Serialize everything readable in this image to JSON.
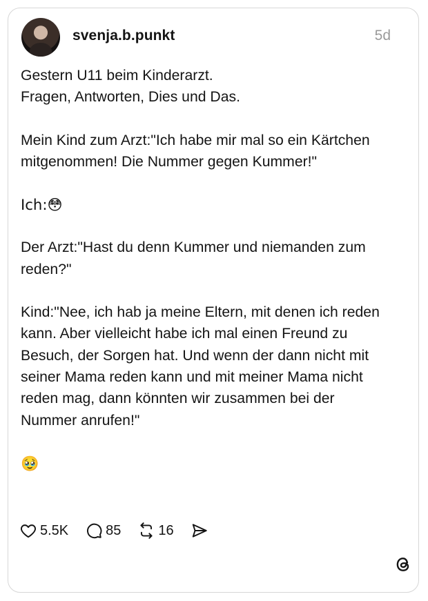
{
  "post": {
    "username": "svenja.b.punkt",
    "time": "5d",
    "paragraphs": [
      "Gestern U11 beim Kinderarzt.\nFragen, Antworten, Dies und Das.",
      "Mein Kind zum Arzt:\"Ich habe mir mal so ein Kärtchen mitgenommen! Die Nummer gegen Kummer!\"",
      "Ich:😳",
      "Der Arzt:\"Hast du denn Kummer und niemanden zum reden?\"",
      "Kind:\"Nee, ich hab ja meine Eltern, mit denen ich reden kann. Aber vielleicht habe ich mal einen Freund zu Besuch, der Sorgen hat. Und wenn der dann nicht mit seiner Mama reden kann und mit meiner Mama nicht reden mag, dann könnten wir zusammen bei der Nummer anrufen!\"",
      "🥹"
    ]
  },
  "actions": {
    "likes": "5.5K",
    "comments": "85",
    "reposts": "16"
  },
  "icons": [
    "heart-icon",
    "comment-icon",
    "repost-icon",
    "share-icon",
    "threads-logo-icon"
  ]
}
